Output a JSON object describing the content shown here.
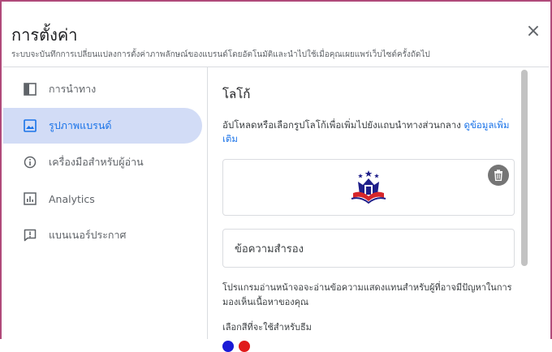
{
  "header": {
    "title": "การตั้งค่า",
    "subtitle": "ระบบจะบันทึกการเปลี่ยนแปลงการตั้งค่าภาพลักษณ์ของแบรนด์โดยอัตโนมัติและนำไปใช้เมื่อคุณเผยแพร่เว็บไซต์ครั้งถัดไป",
    "close_icon": "×"
  },
  "sidebar": {
    "items": [
      {
        "label": "การนำทาง",
        "icon": "navigation-icon"
      },
      {
        "label": "รูปภาพแบรนด์",
        "icon": "image-icon",
        "active": true
      },
      {
        "label": "เครื่องมือสำหรับผู้อ่าน",
        "icon": "info-icon"
      },
      {
        "label": "Analytics",
        "icon": "analytics-icon"
      },
      {
        "label": "แบนเนอร์ประกาศ",
        "icon": "announcement-icon"
      }
    ]
  },
  "main": {
    "section_title": "โลโก้",
    "description": "อัปโหลดหรือเลือกรูปโลโก้เพื่อเพิ่มไปยังแถบนำทางส่วนกลาง",
    "learn_more": "ดูข้อมูลเพิ่มเติม",
    "alt_text_placeholder": "ข้อความสำรอง",
    "helper_text": "โปรแกรมอ่านหน้าจอจะอ่านข้อความแสดงแทนสำหรับผู้ที่อาจมีปัญหาในการมองเห็นเนื้อหาของคุณ",
    "theme_color_label": "เลือกสีที่จะใช้สำหรับธีม",
    "theme_colors": [
      "#1a1ad6",
      "#e01b1b"
    ]
  },
  "colors": {
    "accent": "#1a73e8",
    "active_bg": "#d2dcf6",
    "frame_border": "#b04a7a"
  }
}
